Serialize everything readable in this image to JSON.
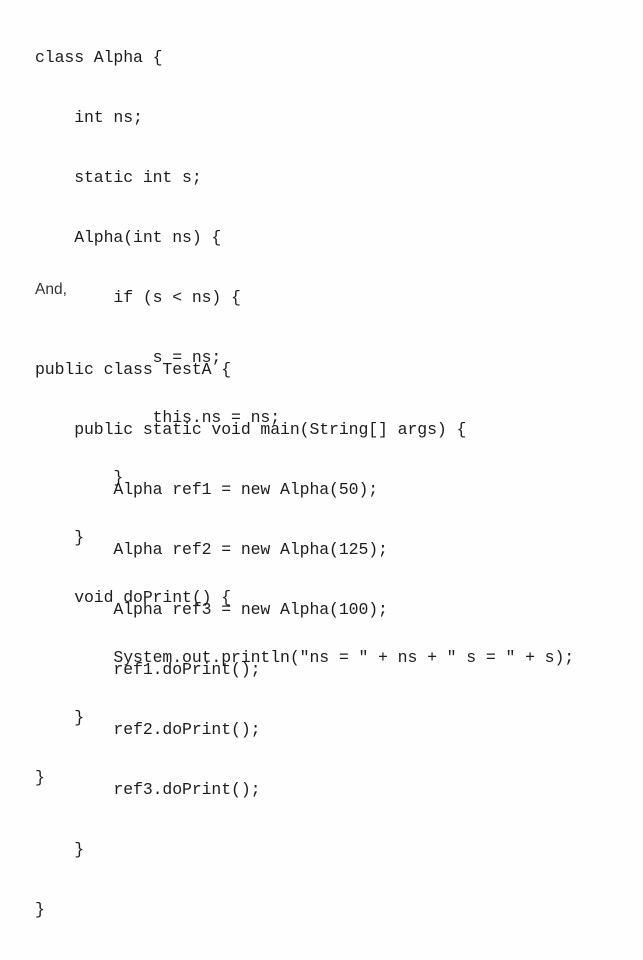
{
  "document": {
    "type": "java-source-code-listing",
    "background_color": "#fefefe",
    "text_color": "#1d1d1d",
    "separator_text": "And,",
    "alpha_class": {
      "title": "class Alpha",
      "lines": [
        "class Alpha {",
        "    int ns;",
        "    static int s;",
        "    Alpha(int ns) {",
        "        if (s < ns) {",
        "            s = ns;",
        "            this.ns = ns;",
        "        }",
        "    }",
        "    void doPrint() {",
        "        System.out.println(\"ns = \" + ns + \" s = \" + s);",
        "    }",
        "}"
      ]
    },
    "testa_class": {
      "title": "public class TestA",
      "lines": [
        "public class TestA {",
        "    public static void main(String[] args) {",
        "        Alpha ref1 = new Alpha(50);",
        "        Alpha ref2 = new Alpha(125);",
        "        Alpha ref3 = new Alpha(100);",
        "        ref1.doPrint();",
        "        ref2.doPrint();",
        "        ref3.doPrint();",
        "    }",
        "}"
      ]
    }
  }
}
